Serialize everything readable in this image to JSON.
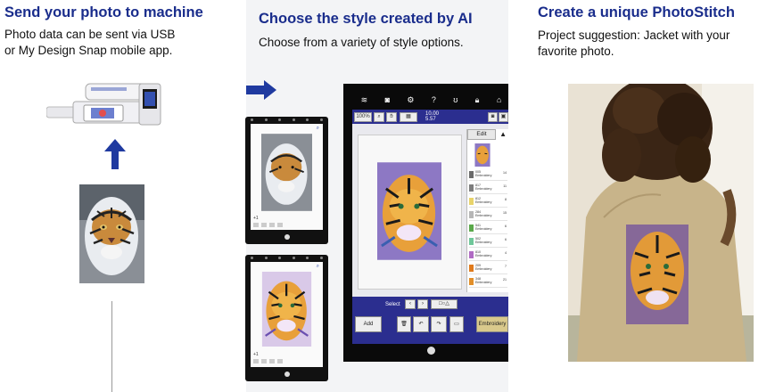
{
  "steps": [
    {
      "title": "Send your photo to machine",
      "desc_line1": "Photo data can be sent via USB",
      "desc_line2": "or My Design Snap mobile app."
    },
    {
      "title": "Choose the style created by AI",
      "desc_line1": "Choose from a variety of style options."
    },
    {
      "title": "Create a unique PhotoStitch",
      "desc_line1": "Project suggestion: Jacket with your",
      "desc_line2": "favorite photo."
    }
  ],
  "phone_screen": {
    "toggle_value": "+1"
  },
  "machine_screen": {
    "zoom_label": "100%",
    "time_line1": "10.00",
    "time_line2": "5.57",
    "edit_label": "Edit",
    "select_label": "Select",
    "add_label": "Add",
    "embroidery_label": "Embroidery",
    "thread_list": [
      {
        "code": "005",
        "name": "Embroidery",
        "count": "14",
        "color": "#6b6b6b"
      },
      {
        "code": "817",
        "name": "Embroidery",
        "count": "11",
        "color": "#7c7c7c"
      },
      {
        "code": "812",
        "name": "Embroidery",
        "count": "8",
        "color": "#e8d36a"
      },
      {
        "code": "284",
        "name": "Embroidery",
        "count": "15",
        "color": "#b6b6b6"
      },
      {
        "code": "541",
        "name": "Embroidery",
        "count": "6",
        "color": "#5aa84a"
      },
      {
        "code": "502",
        "name": "Embroidery",
        "count": "6",
        "color": "#6fc79a"
      },
      {
        "code": "810",
        "name": "Embroidery",
        "count": "4",
        "color": "#b06bc4"
      },
      {
        "code": "209",
        "name": "Embroidery",
        "count": "7",
        "color": "#e07a1c"
      },
      {
        "code": "348",
        "name": "Embroidery",
        "count": "21",
        "color": "#e28f2a"
      }
    ]
  },
  "colors": {
    "heading": "#1a2d8c",
    "arrow": "#1f3aa0",
    "screen_blue": "#2b2e8f"
  }
}
